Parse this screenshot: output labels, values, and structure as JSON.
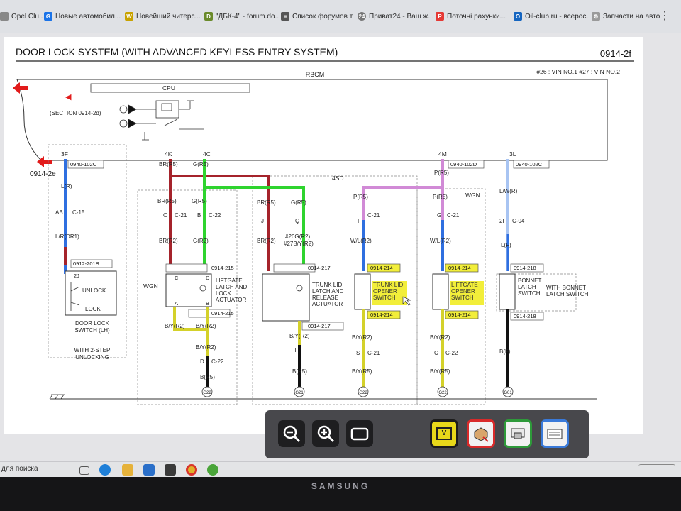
{
  "browser": {
    "tabs": [
      {
        "label": "Opel Clu...",
        "fav": "#888888",
        "glyph": ""
      },
      {
        "label": "Новые автомобил...",
        "fav": "#1a73e8",
        "glyph": "G"
      },
      {
        "label": "Новейший читерс...",
        "fav": "#c8a200",
        "glyph": "W"
      },
      {
        "label": "\"ДБК-4\" - forum.do...",
        "fav": "#6a8a2a",
        "glyph": "D"
      },
      {
        "label": "Список форумов т...",
        "fav": "#555555",
        "glyph": "≡"
      },
      {
        "label": "Приват24 - Ваш ж...",
        "fav": "#777777",
        "glyph": "24"
      },
      {
        "label": "Поточні рахунки...",
        "fav": "#e53935",
        "glyph": "P"
      },
      {
        "label": "Oil-club.ru - всерос...",
        "fav": "#1565c0",
        "glyph": "O"
      },
      {
        "label": "Запчасти на авто -...",
        "fav": "#9a9a9a",
        "glyph": "⚙"
      }
    ],
    "more_icon": "⋮"
  },
  "diagram": {
    "title": "DOOR LOCK SYSTEM (WITH ADVANCED KEYLESS ENTRY SYSTEM)",
    "page_code": "0914-2f",
    "vin_note": "#26 : VIN NO.1    #27 : VIN NO.2",
    "rbcm": "RBCM",
    "cpu": "CPU",
    "section_ref": "(SECTION 0914-2d)",
    "ref_left_top": "0914-2e",
    "pins": {
      "p3f": "3F",
      "p4k": "4K",
      "p4c": "4C",
      "p4m": "4M",
      "p3l": "3L"
    },
    "boxes": {
      "b102c": "0940-102C",
      "b102d": "0940-102D",
      "b102c2": "0940-102C",
      "b201b": "0912-201B",
      "b215a": "0914-215",
      "b215b": "0914-215",
      "b217a": "0914-217",
      "b217b": "0914-217",
      "b214a": "0914-214",
      "b214b": "0914-214",
      "b214c": "0914-214",
      "b214d": "0914-214",
      "b218a": "0914-218",
      "b218b": "0914-218"
    },
    "wires": {
      "l_r": "L(R)",
      "lr_dr1": "L/R(DR1)",
      "ab": "AB",
      "c15": "C-15",
      "br_r5_a": "BR(R5)",
      "g_r5_a": "G(R5)",
      "br_r5_b": "BR(R5)",
      "g_r5_b": "G(R5)",
      "o": "O",
      "c21a": "C-21",
      "b": "B",
      "c22a": "C-22",
      "br_r2_a": "BR(R2)",
      "g_r2": "G(R2)",
      "br_r5_c": "BR(R5)",
      "g_r5_c": "G(R5)",
      "j": "J",
      "q": "Q",
      "br_r2_b": "BR(R2)",
      "g26": "#26G(R2)",
      "y27": "#27B/Y(R2)",
      "p_r5_a": "P(R5)",
      "i": "I",
      "c21b": "C-21",
      "wl_r2_a": "W/L(R2)",
      "p_r5_b": "P(R5)",
      "p_r5_c": "P(R5)",
      "g": "G",
      "c21c": "C-21",
      "wl_r2_b": "W/L(R2)",
      "lw_r": "L/W(R)",
      "two_i": "2I",
      "c04": "C-04",
      "l_f": "L(F)",
      "by_r2_a": "B/Y(R2)",
      "by_r2_b": "B/Y(R2)",
      "by_r2_c": "B/Y(R2)",
      "d": "D",
      "c22b": "C-22",
      "b_r5_a": "B(R5)",
      "by_r2_d": "B/Y(R2)",
      "t": "T",
      "b_r5_b": "B(R5)",
      "by_r2_e": "B/Y(R2)",
      "s": "S",
      "c21d": "C-21",
      "by_r5_a": "B/Y(R5)",
      "by_r2_f": "B/Y(R2)",
      "c": "C",
      "c22c": "C-22",
      "by_r5_b": "B/Y(R5)",
      "b_f": "B(F)"
    },
    "labels": {
      "unlock": "UNLOCK",
      "lock": "LOCK",
      "door_switch": "DOOR LOCK\nSWITCH (LH)",
      "two_step": "WITH 2-STEP\nUNLOCKING",
      "wgn_left": "WGN",
      "wgn_right": "WGN",
      "four_sd": "4SD",
      "liftgate_latch": "LIFTGATE\nLATCH AND\nLOCK\nACTUATOR",
      "trunk_latch": "TRUNK LID\nLATCH AND\nRELEASE\nACTUATOR",
      "trunk_opener": "TRUNK LID\nOPENER\nSWITCH",
      "liftgate_opener": "LIFTGATE\nOPENER\nSWITCH",
      "bonnet_latch": "BONNET\nLATCH\nSWITCH",
      "with_bonnet": "WITH BONNET\nLATCH SWITCH",
      "pin_2j": "2J",
      "pin_c": "C",
      "pin_d": "D",
      "pin_a": "A",
      "pin_b": "B"
    },
    "grounds": [
      "G22",
      "G21",
      "G22",
      "G22",
      "G01"
    ]
  },
  "toolbar": {
    "zoom_out": "zoom-out",
    "zoom_in": "zoom-in",
    "fit": "fit-screen",
    "v_label": "V"
  },
  "taskbar": {
    "search": "для поиска"
  },
  "monitor": {
    "brand": "SAMSUNG"
  },
  "colors": {
    "brown_red": "#a5232b",
    "green": "#2ed42e",
    "pink": "#d18ad6",
    "blue": "#2f6fe0",
    "light_blue": "#a8c4f2",
    "yellow": "#d4d12a",
    "black": "#111111",
    "highlight": "#f2ee3a",
    "red_arrow": "#e21b1b"
  }
}
